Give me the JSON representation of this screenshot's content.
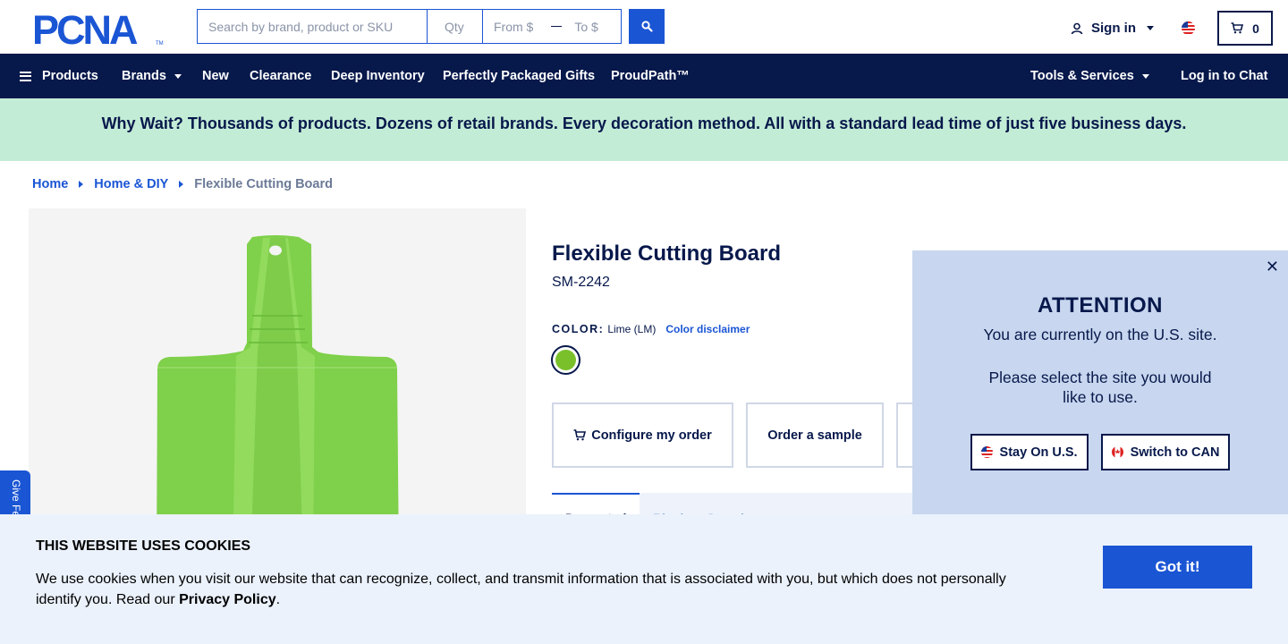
{
  "header": {
    "logo_text": "PCNA",
    "search": {
      "placeholder": "Search by brand, product or SKU",
      "qty_placeholder": "Qty",
      "from_placeholder": "From $",
      "to_placeholder": "To $"
    },
    "signin_label": "Sign in",
    "cart_count": "0"
  },
  "nav": {
    "products": "Products",
    "brands": "Brands",
    "new": "New",
    "clearance": "Clearance",
    "deep_inventory": "Deep Inventory",
    "gifts": "Perfectly Packaged Gifts",
    "proudpath": "ProudPath™",
    "tools": "Tools & Services",
    "chat": "Log in to Chat"
  },
  "promo": {
    "text": "Why Wait? Thousands of products. Dozens of retail brands. Every decoration method. All with a standard lead time of just five business days."
  },
  "breadcrumb": {
    "home": "Home",
    "category": "Home & DIY",
    "current": "Flexible Cutting Board"
  },
  "product": {
    "title": "Flexible Cutting Board",
    "sku": "SM-2242",
    "color_label": "COLOR:",
    "color_value": "Lime (LM)",
    "color_disclaimer": "Color disclaimer",
    "swatch_color": "#7ac02b",
    "configure_label": "Configure my order",
    "sample_label": "Order a sample",
    "tab_active": "Decorated",
    "tab_other": "Blank or Sample"
  },
  "attention": {
    "title": "ATTENTION",
    "line1": "You are currently on the U.S. site.",
    "line2": "Please select the site you would like to use.",
    "stay_label": "Stay On U.S.",
    "switch_label": "Switch to CAN"
  },
  "feedback": {
    "label": "Give Feedback"
  },
  "cookie": {
    "title": "THIS WEBSITE USES COOKIES",
    "text": "We use cookies when you visit our website that can recognize, collect, and transmit information that is associated with you, but which does not personally identify you. Read our ",
    "link": "Privacy Policy",
    "end": ".",
    "button": "Got it!"
  },
  "colors": {
    "navy": "#07184b",
    "accent_blue": "#1a55d4",
    "promo_green": "#c3ecd6",
    "popup_bg": "#c8d7ef",
    "cookie_bg": "#ebf2fc"
  }
}
